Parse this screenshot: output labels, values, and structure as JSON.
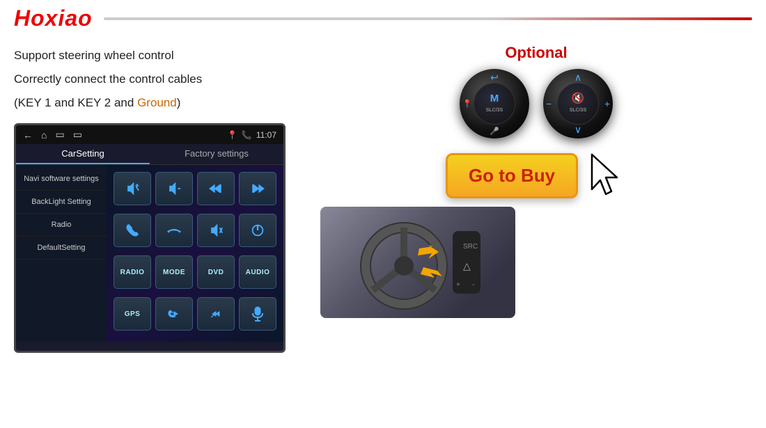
{
  "header": {
    "brand": "Hoxiao"
  },
  "left": {
    "lines": [
      "Support steering wheel control",
      "Correctly connect the control cables",
      "(KEY 1 and KEY 2 and Ground)"
    ],
    "ground_word": "Ground"
  },
  "screen": {
    "topbar": {
      "icons": [
        "←",
        "⌂",
        "▭",
        "▭"
      ],
      "right_icons": [
        "📍",
        "📞"
      ],
      "time": "11:07"
    },
    "tabs": [
      {
        "label": "CarSetting",
        "active": true
      },
      {
        "label": "Factory settings",
        "active": false
      }
    ],
    "menu_items": [
      "Navi software settings",
      "BackLight Setting",
      "Radio",
      "DefaultSetting"
    ],
    "control_buttons": [
      {
        "type": "icon",
        "label": "vol+"
      },
      {
        "type": "icon",
        "label": "vol-"
      },
      {
        "type": "icon",
        "label": "prev"
      },
      {
        "type": "icon",
        "label": "next"
      },
      {
        "type": "icon",
        "label": "call"
      },
      {
        "type": "icon",
        "label": "hangup"
      },
      {
        "type": "icon",
        "label": "mute"
      },
      {
        "type": "icon",
        "label": "power"
      },
      {
        "type": "text",
        "label": "RADIO"
      },
      {
        "type": "text",
        "label": "MODE"
      },
      {
        "type": "text",
        "label": "DVD"
      },
      {
        "type": "text",
        "label": "AUDIO"
      },
      {
        "type": "text",
        "label": "GPS"
      },
      {
        "type": "icon",
        "label": "prev-call"
      },
      {
        "type": "icon",
        "label": "next-skip"
      },
      {
        "type": "icon",
        "label": "mic"
      }
    ]
  },
  "right": {
    "optional_label": "Optional",
    "controllers": [
      {
        "center_text": "M\nSLC/3S",
        "has_arrows": [
          "↩",
          "◉",
          "🎤"
        ],
        "side_label": "left"
      },
      {
        "center_text": "🔇\nSLC/3S",
        "has_arrows": [
          "^",
          "-",
          "+",
          "v"
        ],
        "side_label": "right"
      }
    ],
    "go_to_buy_label": "Go to Buy"
  }
}
